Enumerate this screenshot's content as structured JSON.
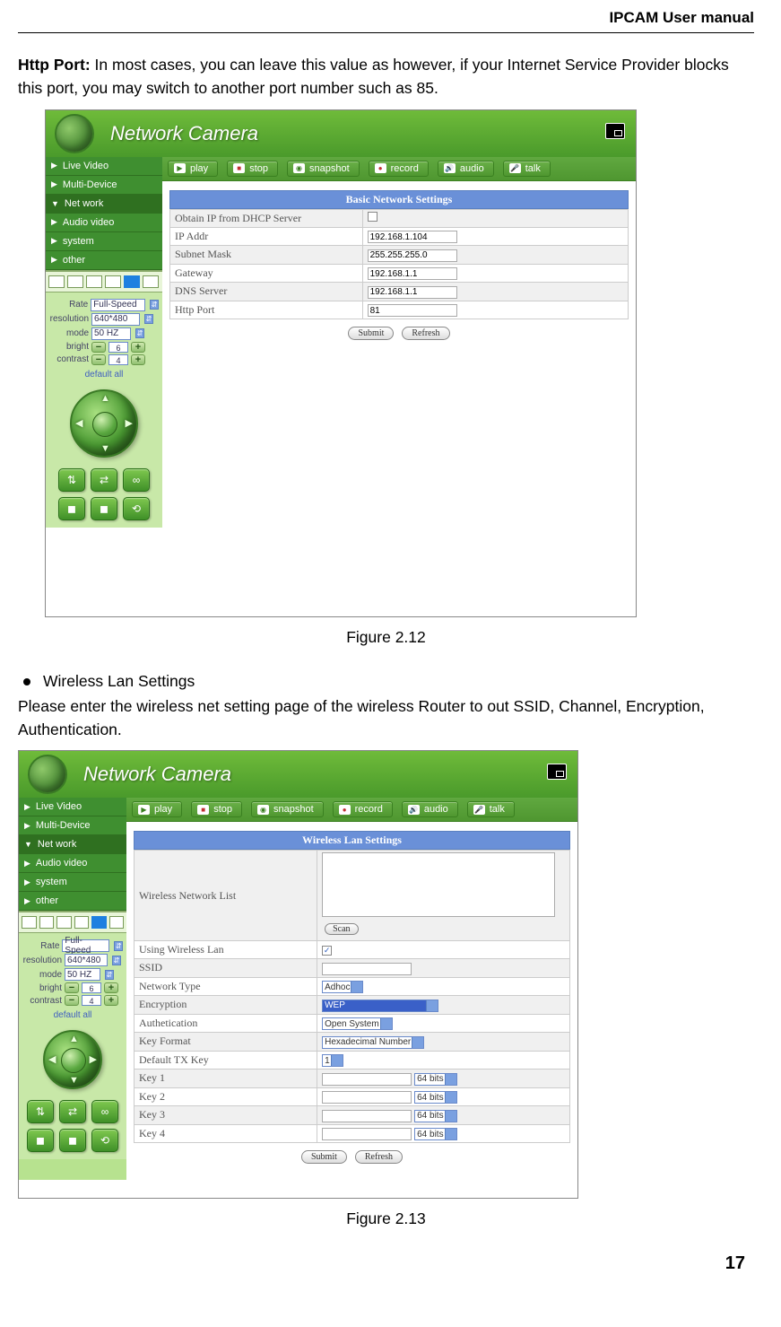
{
  "doc": {
    "header": "IPCAM User manual",
    "para1_bold": "Http Port:",
    "para1": " In most cases, you can leave this value as however, if your Internet Service Provider blocks this port, you may switch to another port number such as 85.",
    "fig1_caption": "Figure 2.12",
    "bullet1": "Wireless Lan Settings",
    "para2": "Please enter the wireless net setting page of the wireless Router to out SSID, Channel, Encryption, Authentication.",
    "fig2_caption": "Figure 2.13",
    "page_num": "17"
  },
  "app": {
    "title": "Network Camera",
    "nav": [
      "Live Video",
      "Multi-Device",
      "Net work",
      "Audio video",
      "system",
      "other"
    ],
    "toolbar": [
      "play",
      "stop",
      "snapshot",
      "record",
      "audio",
      "talk"
    ],
    "ctrl": {
      "rate_lbl": "Rate",
      "rate": "Full-Speed",
      "res_lbl": "resolution",
      "res": "640*480",
      "mode_lbl": "mode",
      "mode": "50 HZ",
      "bright_lbl": "bright",
      "bright": "6",
      "contrast_lbl": "contrast",
      "contrast": "4",
      "default": "default all"
    }
  },
  "fig1": {
    "panel_title": "Basic Network Settings",
    "rows": [
      {
        "label": "Obtain IP from DHCP Server",
        "type": "chk",
        "value": false
      },
      {
        "label": "IP Addr",
        "type": "text",
        "value": "192.168.1.104"
      },
      {
        "label": "Subnet Mask",
        "type": "text",
        "value": "255.255.255.0"
      },
      {
        "label": "Gateway",
        "type": "text",
        "value": "192.168.1.1"
      },
      {
        "label": "DNS Server",
        "type": "text",
        "value": "192.168.1.1"
      },
      {
        "label": "Http Port",
        "type": "text",
        "value": "81"
      }
    ],
    "submit": "Submit",
    "refresh": "Refresh"
  },
  "fig2": {
    "panel_title": "Wireless Lan Settings",
    "list_label": "Wireless Network List",
    "scan": "Scan",
    "rows": [
      {
        "label": "Using Wireless Lan",
        "type": "chk",
        "value": true
      },
      {
        "label": "SSID",
        "type": "text",
        "value": ""
      },
      {
        "label": "Network Type",
        "type": "sel",
        "value": "Adhoc"
      },
      {
        "label": "Encryption",
        "type": "selhl",
        "value": "WEP"
      },
      {
        "label": "Authetication",
        "type": "sel",
        "value": "Open System"
      },
      {
        "label": "Key Format",
        "type": "sel",
        "value": "Hexadecimal Number"
      },
      {
        "label": "Default TX Key",
        "type": "sel",
        "value": "1"
      },
      {
        "label": "Key 1",
        "type": "key",
        "value": "",
        "bits": "64 bits"
      },
      {
        "label": "Key 2",
        "type": "key",
        "value": "",
        "bits": "64 bits"
      },
      {
        "label": "Key 3",
        "type": "key",
        "value": "",
        "bits": "64 bits"
      },
      {
        "label": "Key 4",
        "type": "key",
        "value": "",
        "bits": "64 bits"
      }
    ],
    "submit": "Submit",
    "refresh": "Refresh"
  }
}
